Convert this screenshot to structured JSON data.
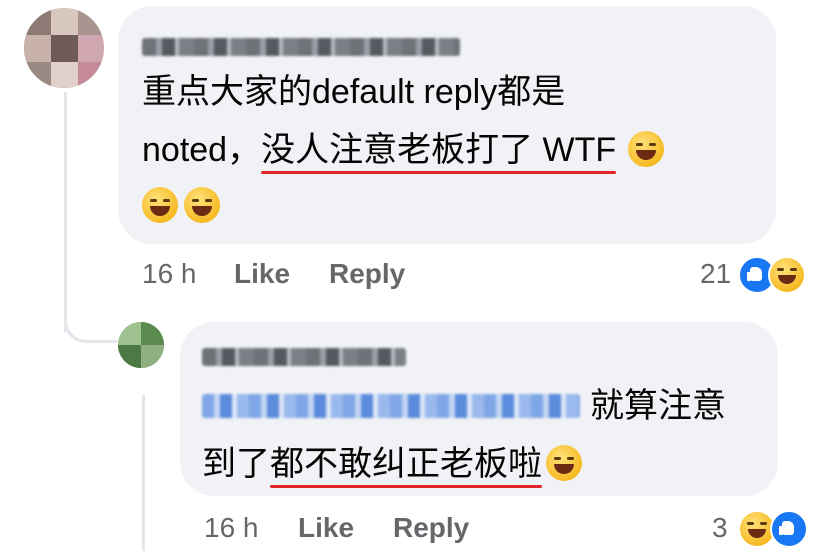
{
  "comment1": {
    "author_name": "",
    "text_line1": "重点大家的default reply都是",
    "text_line2_plain": "noted，",
    "text_line2_underlined": "没人注意老板打了 WTF",
    "emoji_name": "rolling-on-floor-laughing",
    "time": "16 h",
    "like_label": "Like",
    "reply_label": "Reply",
    "reaction_count": "21",
    "reactions": [
      "like",
      "haha"
    ]
  },
  "comment2": {
    "author_name": "",
    "mention_name": "",
    "text_line1": "就算注意",
    "text_line2_plain": "到了",
    "text_line2_underlined": "都不敢纠正老板啦",
    "emoji_name": "grinning-squinting-face",
    "time": "16 h",
    "like_label": "Like",
    "reply_label": "Reply",
    "reaction_count": "3",
    "reactions": [
      "haha",
      "like"
    ]
  },
  "colors": {
    "bubble": "#f0f2f5",
    "meta_text": "#65676b",
    "underline": "#e3242b",
    "like_blue": "#1877f2",
    "mention_blue": "#7fa6e6"
  }
}
